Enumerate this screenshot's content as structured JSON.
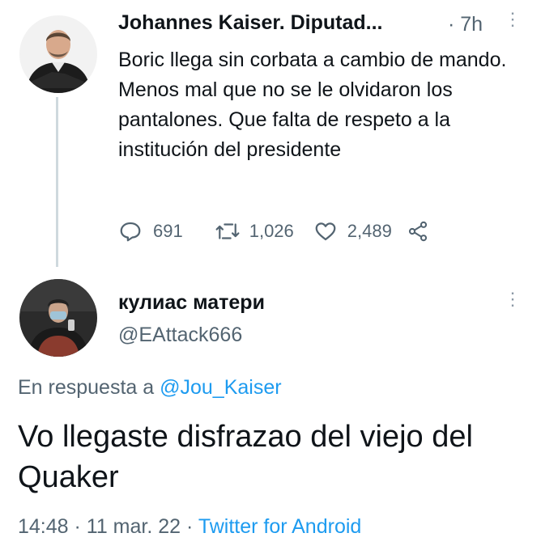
{
  "tweet1": {
    "author_name": "Johannes Kaiser. Diputad...",
    "time": "· 7h",
    "text": "Boric llega sin corbata a cambio de mando. Menos mal que no se le olvidaron los pantalones. Que falta de respeto a la institución del presidente",
    "replies": "691",
    "retweets": "1,026",
    "likes": "2,489",
    "icons": [
      "reply-icon",
      "retweet-icon",
      "like-icon",
      "share-icon",
      "more-icon"
    ]
  },
  "tweet2": {
    "author_name": "кулиас матери",
    "handle": "@EAttack666",
    "reply_prefix": "En respuesta a ",
    "reply_mention": "@Jou_Kaiser",
    "text": "Vo llegaste disfrazao del viejo del Quaker",
    "timestamp": "14:48 · 11 mar. 22 · ",
    "source": "Twitter for Android",
    "icons": [
      "more-icon"
    ]
  },
  "colors": {
    "link": "#1d9bf0",
    "secondary_text": "#536471",
    "thread_line": "#cfd9de"
  }
}
